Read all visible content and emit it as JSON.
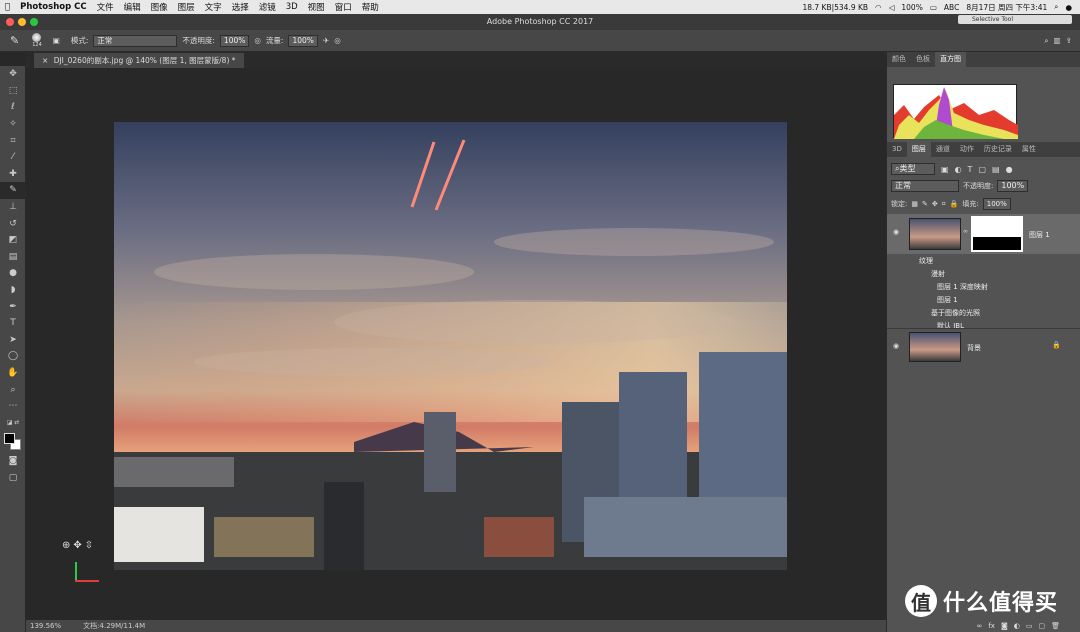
{
  "menubar": {
    "app_name": "Photoshop CC",
    "items": [
      "文件",
      "编辑",
      "图像",
      "图层",
      "文字",
      "选择",
      "滤镜",
      "3D",
      "视图",
      "窗口",
      "帮助"
    ],
    "net_stats": "18.7 KB|534.9 KB",
    "battery": "100%",
    "input": "ABC",
    "clock": "8月17日 周四 下午3:41"
  },
  "window": {
    "title": "Adobe Photoshop CC 2017",
    "popup": "Selective Tool"
  },
  "options": {
    "brush_size": "124",
    "mode_label": "模式:",
    "mode_value": "正常",
    "opacity_label": "不透明度:",
    "opacity_value": "100%",
    "flow_label": "流量:",
    "flow_value": "100%"
  },
  "document": {
    "tab_title": "DJI_0260的副本.jpg @ 140% (图层 1, 图层蒙版/8) *"
  },
  "status": {
    "zoom": "139.56%",
    "doc_size": "文档:4.29M/11.4M"
  },
  "panels": {
    "top_tabs": [
      "颜色",
      "色板",
      "直方图"
    ],
    "mid_tabs": [
      "3D",
      "图层",
      "通道",
      "动作",
      "历史记录",
      "属性"
    ],
    "filter_label": "类型",
    "blend_mode": "正常",
    "opacity_label": "不透明度:",
    "opacity_value": "100%",
    "lock_label": "锁定:",
    "fill_label": "填充:",
    "fill_value": "100%",
    "layer1_name": "图层 1",
    "effects": [
      "纹理",
      "漫射",
      "图层 1 深度映射",
      "图层 1",
      "基于图像的光照",
      "默认 IBL"
    ],
    "background_name": "背景"
  },
  "watermark": {
    "glyph": "值",
    "text": "什么值得买"
  }
}
